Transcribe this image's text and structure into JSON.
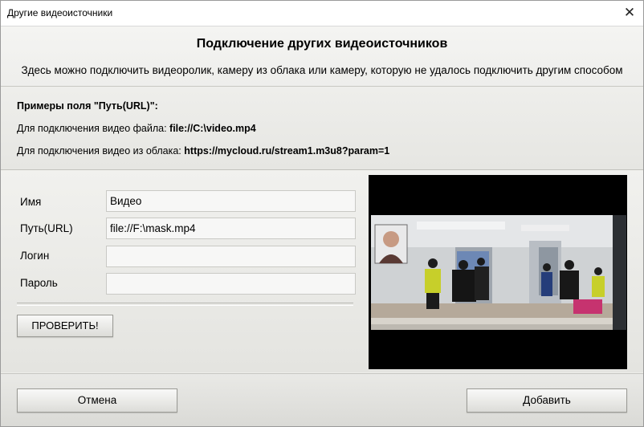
{
  "window": {
    "title": "Другие видеоисточники",
    "close_glyph": "✕"
  },
  "header": {
    "heading": "Подключение других видеоисточников",
    "subheading": "Здесь можно подключить видеоролик, камеру из облака или камеру, которую не удалось подключить другим способом"
  },
  "examples": {
    "title": "Примеры поля \"Путь(URL)\":",
    "file_prefix": "Для подключения видео файла: ",
    "file_value": "file://C:\\video.mp4",
    "cloud_prefix": "Для подключения видео из облака: ",
    "cloud_value": "https://mycloud.ru/stream1.m3u8?param=1"
  },
  "form": {
    "name_label": "Имя",
    "name_value": "Видео",
    "path_label": "Путь(URL)",
    "path_value": "file://F:\\mask.mp4",
    "login_label": "Логин",
    "login_value": "",
    "password_label": "Пароль",
    "password_value": "",
    "check_button": "ПРОВЕРИТЬ!"
  },
  "preview": {
    "icon": "video-preview"
  },
  "footer": {
    "cancel_button": "Отмена",
    "add_button": "Добавить"
  },
  "colors": {
    "window_bg": "#ededea",
    "preview_bg": "#000000",
    "button_bg": "#e6e6e2"
  }
}
